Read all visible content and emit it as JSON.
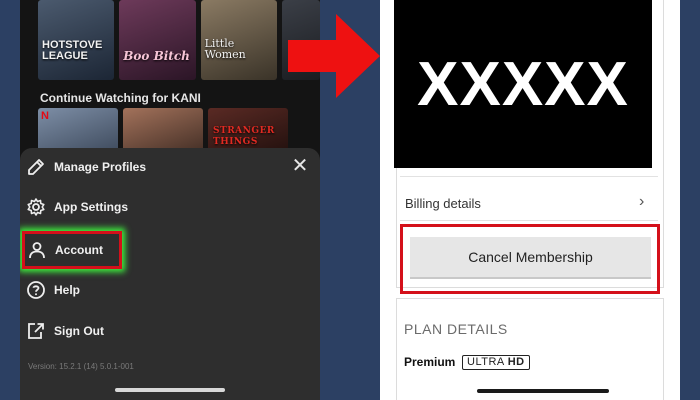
{
  "left_phone": {
    "posters": [
      {
        "title": "HOTSTOVE LEAGUE"
      },
      {
        "title": "Boo Bitch"
      },
      {
        "title": "Little Women"
      }
    ],
    "continue_label": "Continue Watching for KANI",
    "continue_posters": [
      {
        "badge": "N",
        "title": ""
      },
      {
        "badge": "",
        "title": ""
      },
      {
        "badge": "",
        "title": "STRANGER THINGS"
      }
    ],
    "menu": {
      "close_icon": "close-icon",
      "items": [
        {
          "label": "Manage Profiles",
          "icon": "pencil-icon"
        },
        {
          "label": "App Settings",
          "icon": "gear-icon"
        },
        {
          "label": "Account",
          "icon": "user-icon"
        },
        {
          "label": "Help",
          "icon": "help-icon"
        },
        {
          "label": "Sign Out",
          "icon": "sign-out-icon"
        }
      ],
      "version": "Version: 15.2.1 (14) 5.0.1-001"
    }
  },
  "arrow": {
    "color": "#ee1111"
  },
  "right_phone": {
    "redacted_text": "XXXXX",
    "billing_label": "Billing details",
    "cancel_label": "Cancel Membership",
    "plan_heading": "PLAN DETAILS",
    "plan_name": "Premium",
    "plan_badge_a": "ULTRA",
    "plan_badge_b": "HD"
  },
  "colors": {
    "highlight_red": "#d4101a",
    "highlight_green_glow": "#3ef23e",
    "background": "#2c4063"
  }
}
